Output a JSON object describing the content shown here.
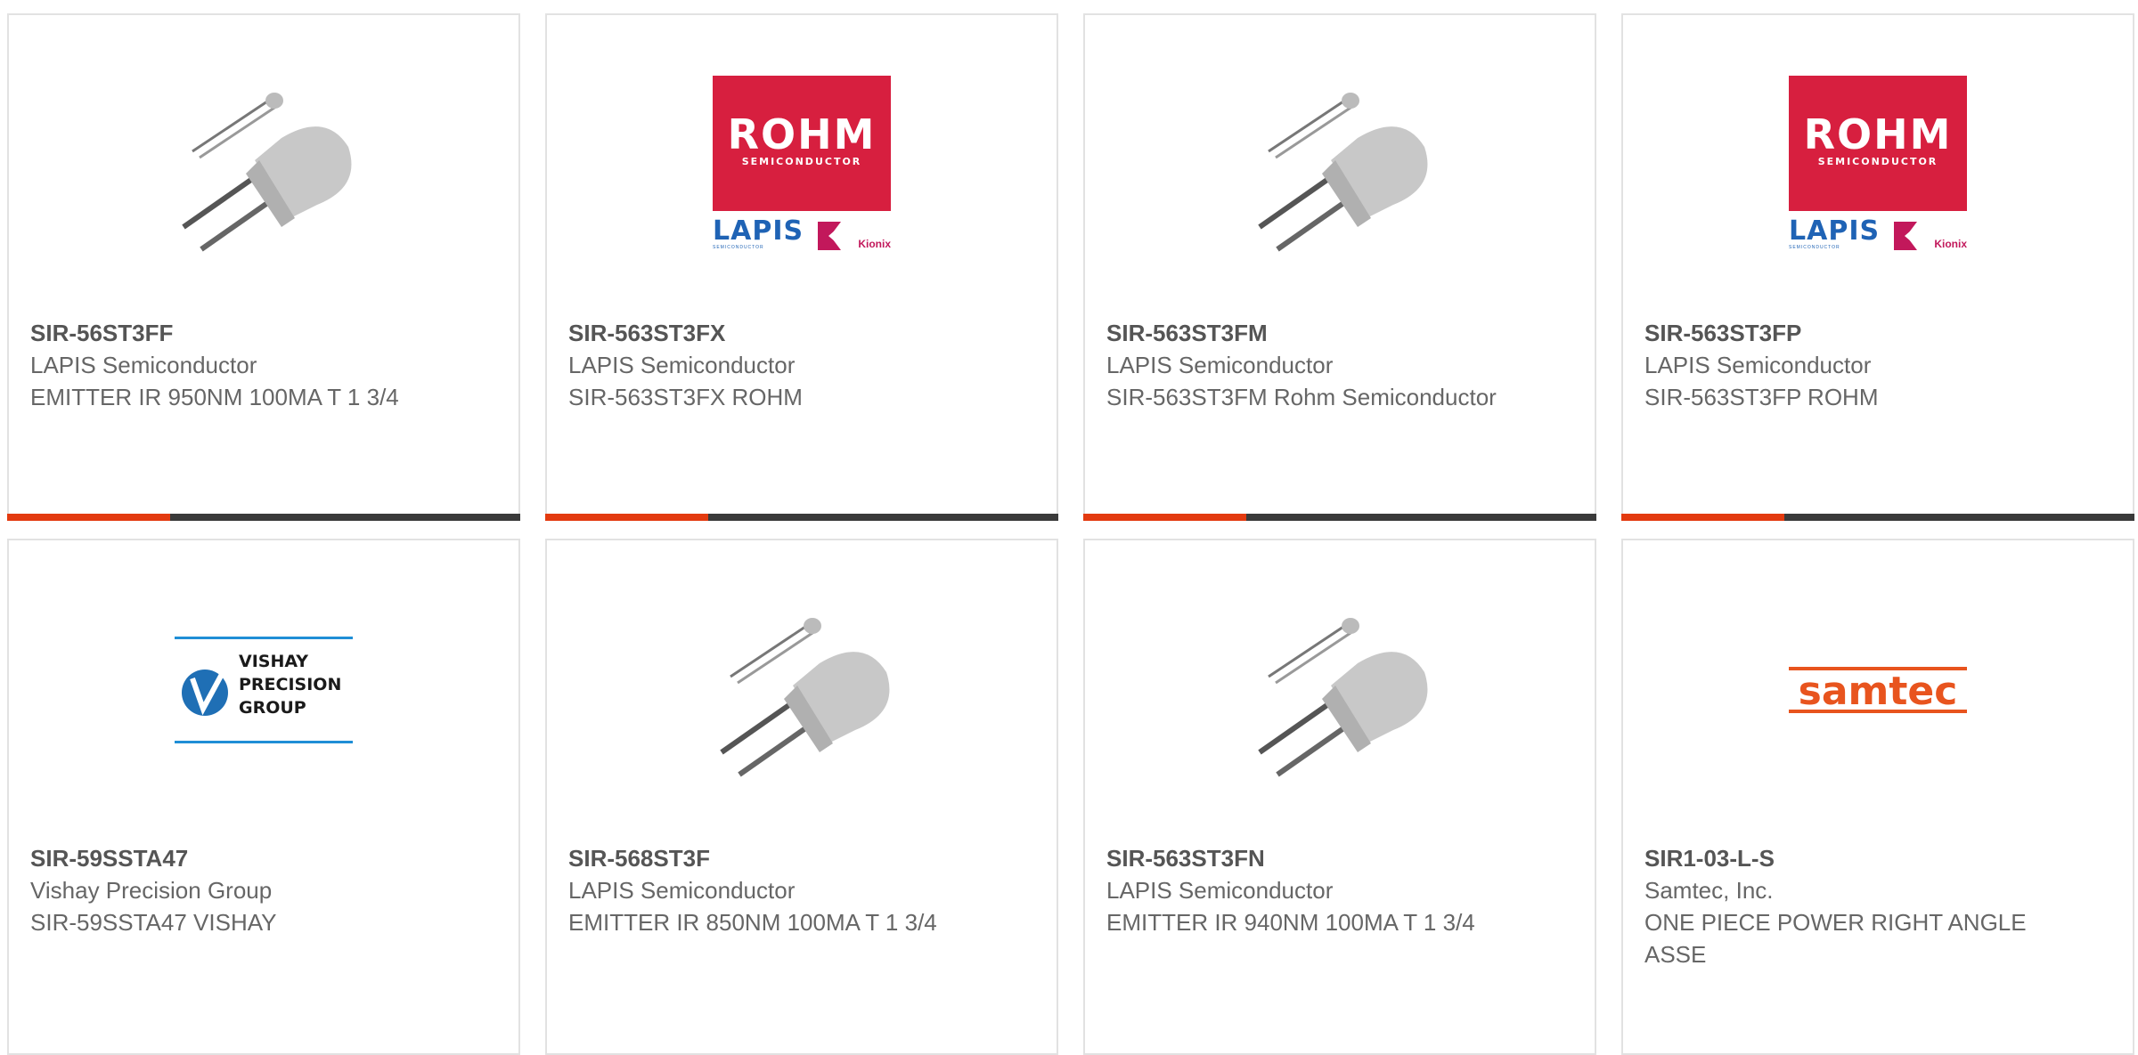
{
  "products": [
    {
      "part": "SIR-56ST3FF",
      "manufacturer": "LAPIS Semiconductor",
      "description": "EMITTER IR 950NM 100MA T 1 3/4",
      "image": "ir-led-photo"
    },
    {
      "part": "SIR-563ST3FX",
      "manufacturer": "LAPIS Semiconductor",
      "description": "SIR-563ST3FX ROHM",
      "image": "rohm-lapis-logo"
    },
    {
      "part": "SIR-563ST3FM",
      "manufacturer": "LAPIS Semiconductor",
      "description": "SIR-563ST3FM Rohm Semiconductor",
      "image": "ir-led-photo"
    },
    {
      "part": "SIR-563ST3FP",
      "manufacturer": "LAPIS Semiconductor",
      "description": "SIR-563ST3FP ROHM",
      "image": "rohm-lapis-logo"
    },
    {
      "part": "SIR-59SSTA47",
      "manufacturer": "Vishay Precision Group",
      "description": "SIR-59SSTA47 VISHAY",
      "image": "vishay-logo"
    },
    {
      "part": "SIR-568ST3F",
      "manufacturer": "LAPIS Semiconductor",
      "description": "EMITTER IR 850NM 100MA T 1 3/4",
      "image": "ir-led-photo"
    },
    {
      "part": "SIR-563ST3FN",
      "manufacturer": "LAPIS Semiconductor",
      "description": "EMITTER IR 940NM 100MA T 1 3/4",
      "image": "ir-led-photo"
    },
    {
      "part": "SIR1-03-L-S",
      "manufacturer": "Samtec, Inc.",
      "description": "ONE PIECE POWER RIGHT ANGLE ASSE",
      "image": "samtec-logo"
    }
  ],
  "logos": {
    "rohm_word": "ROHM",
    "rohm_sub": "SEMICONDUCTOR",
    "lapis_word": "LAPIS",
    "lapis_sub": "SEMICONDUCTOR",
    "kionix_word": "Kionix",
    "vishay_line1": "VISHAY",
    "vishay_line2": "PRECISION",
    "vishay_line3": "GROUP",
    "samtec_word": "samtec"
  },
  "colors": {
    "accent": "#e33a0f",
    "bar": "#3a3a3a",
    "rohm_red": "#d71f3f",
    "lapis_blue": "#1f63b5",
    "vishay_blue": "#1f8ed6",
    "samtec_orange": "#e8541e"
  }
}
